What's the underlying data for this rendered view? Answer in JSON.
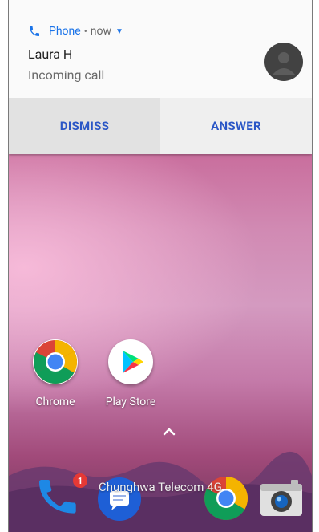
{
  "notification": {
    "app_name": "Phone",
    "separator": "•",
    "time": "now",
    "caller_name": "Laura H",
    "subtitle": "Incoming call",
    "dismiss_label": "DISMISS",
    "answer_label": "ANSWER",
    "accent_color": "#1a73e8",
    "action_color": "#2a56c6"
  },
  "home": {
    "apps": [
      {
        "label": "Chrome",
        "icon": "chrome-icon"
      },
      {
        "label": "Play Store",
        "icon": "play-store-icon"
      }
    ],
    "drawer_handle_icon": "chevron-up-icon"
  },
  "dock": {
    "items": [
      {
        "icon": "phone-icon",
        "badge": "1"
      },
      {
        "icon": "messages-icon"
      },
      {
        "icon": "chrome-icon"
      },
      {
        "icon": "camera-icon"
      }
    ],
    "carrier_text": "Chunghwa Telecom 4G"
  }
}
